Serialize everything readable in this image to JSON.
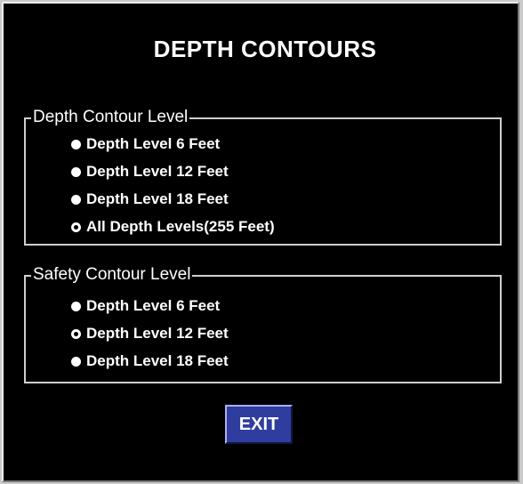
{
  "dialog": {
    "title": "DEPTH CONTOURS"
  },
  "depth_contour_group": {
    "legend": "Depth Contour Level",
    "options": [
      {
        "label": "Depth Level 6 Feet",
        "selected": false
      },
      {
        "label": "Depth Level 12 Feet",
        "selected": false
      },
      {
        "label": "Depth Level 18 Feet",
        "selected": false
      },
      {
        "label": "All Depth Levels(255 Feet)",
        "selected": true
      }
    ]
  },
  "safety_contour_group": {
    "legend": "Safety Contour Level",
    "options": [
      {
        "label": "Depth Level 6 Feet",
        "selected": false
      },
      {
        "label": "Depth Level 12 Feet",
        "selected": true
      },
      {
        "label": "Depth Level 18 Feet",
        "selected": false
      }
    ]
  },
  "actions": {
    "exit_label": "EXIT"
  },
  "colors": {
    "background": "#000000",
    "text": "#ffffff",
    "exit_button": "#2f3d9e",
    "group_border": "#cfcfcf"
  }
}
